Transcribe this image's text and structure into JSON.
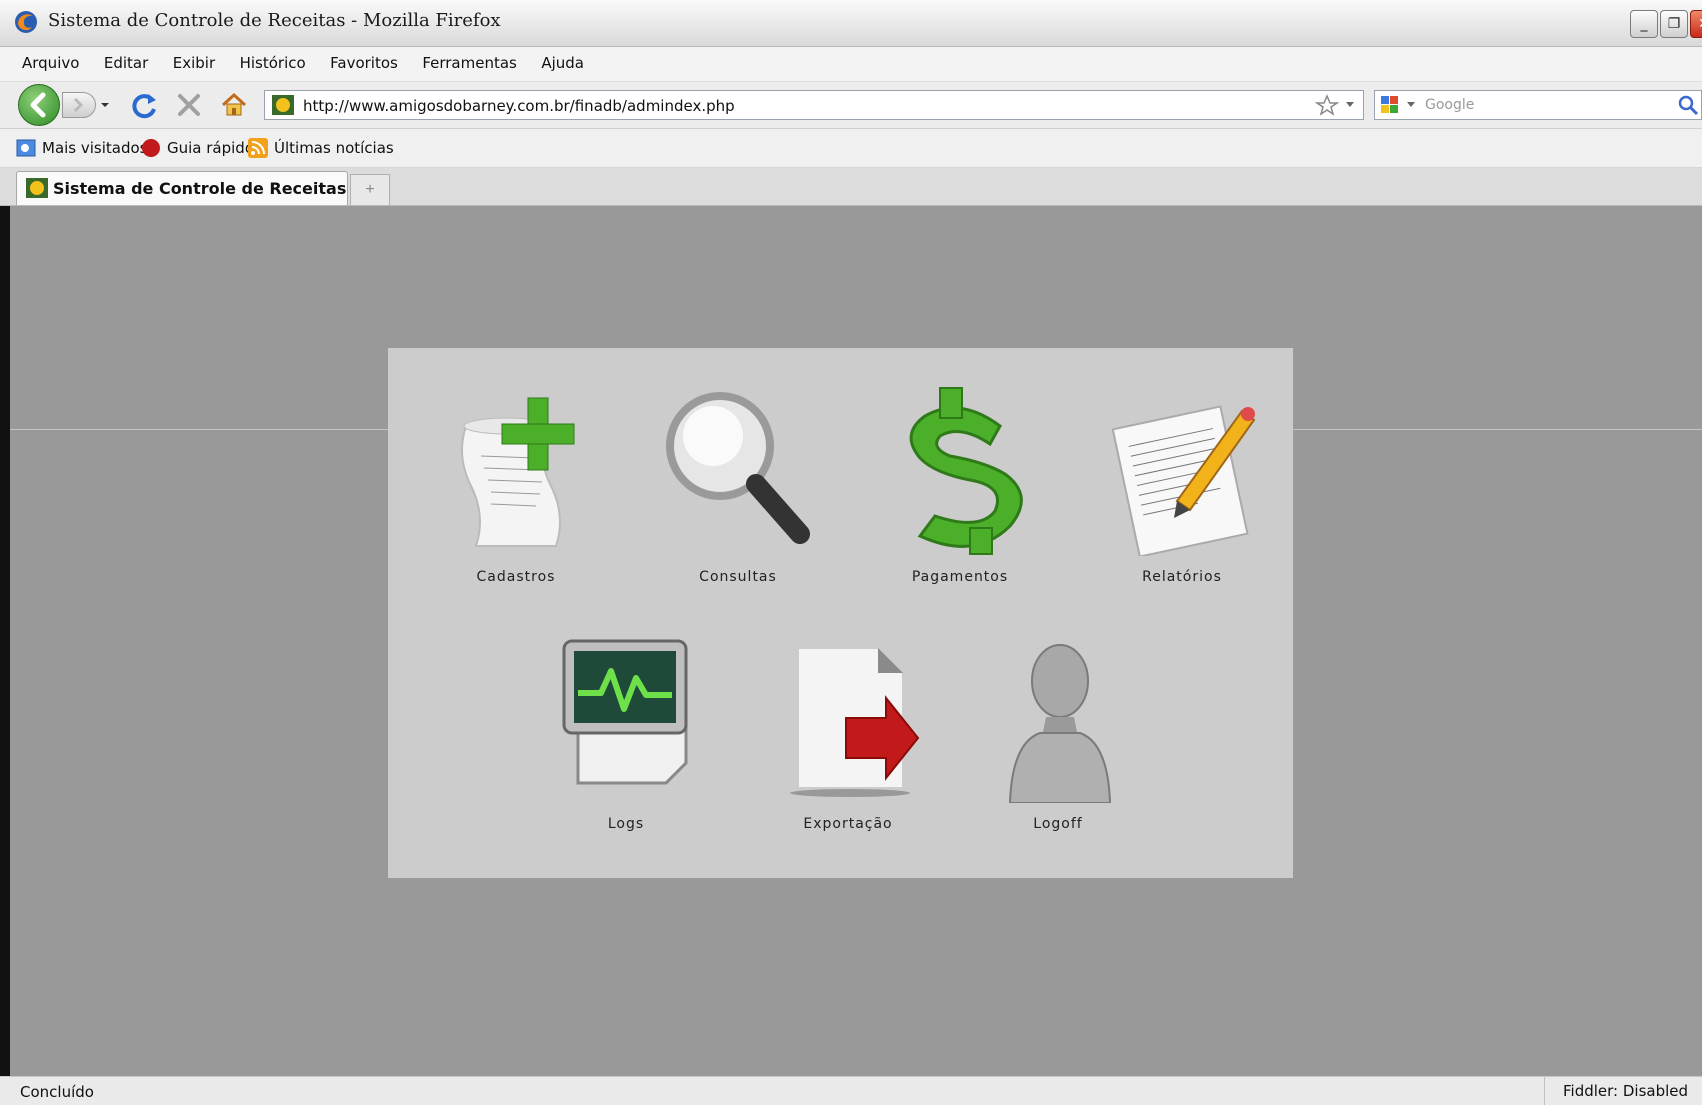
{
  "window": {
    "title": "Sistema de Controle de Receitas - Mozilla Firefox"
  },
  "menu": {
    "items": [
      {
        "label": "Arquivo"
      },
      {
        "label": "Editar"
      },
      {
        "label": "Exibir"
      },
      {
        "label": "Histórico"
      },
      {
        "label": "Favoritos"
      },
      {
        "label": "Ferramentas"
      },
      {
        "label": "Ajuda"
      }
    ]
  },
  "nav": {
    "url": "http://www.amigosdobarney.com.br/finadb/admindex.php",
    "search_placeholder": "Google"
  },
  "bookmarks": [
    {
      "label": "Mais visitados"
    },
    {
      "label": "Guia rápido"
    },
    {
      "label": "Últimas notícias"
    }
  ],
  "tabs": [
    {
      "label": "Sistema de Controle de Receitas"
    }
  ],
  "tiles": [
    {
      "label": "Cadastros",
      "icon": "scroll-add-icon"
    },
    {
      "label": "Consultas",
      "icon": "magnifier-icon"
    },
    {
      "label": "Pagamentos",
      "icon": "dollar-icon"
    },
    {
      "label": "Relatórios",
      "icon": "report-pencil-icon"
    },
    {
      "label": "Logs",
      "icon": "monitor-log-icon"
    },
    {
      "label": "Exportação",
      "icon": "export-arrow-icon"
    },
    {
      "label": "Logoff",
      "icon": "user-bust-icon"
    }
  ],
  "status": {
    "left": "Concluído",
    "right": "Fiddler: Disabled"
  },
  "colors": {
    "background": "#999999",
    "panel": "#cccccc",
    "accent_green": "#4caf2a",
    "export_red": "#c21a1a"
  }
}
